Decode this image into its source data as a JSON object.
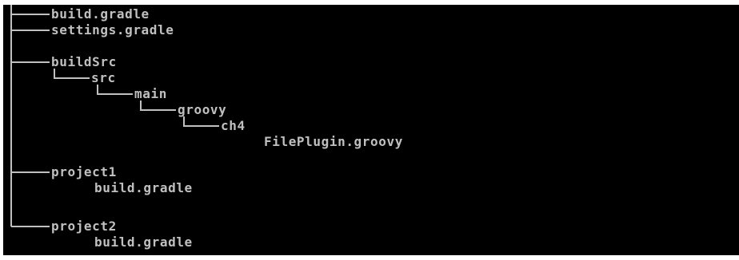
{
  "console": {
    "background": "#000000",
    "foreground": "#c0c0c0",
    "entries": [
      {
        "text": "build.gradle"
      },
      {
        "text": "settings.gradle"
      },
      {
        "text": "buildSrc"
      },
      {
        "text": "src"
      },
      {
        "text": "main"
      },
      {
        "text": "groovy"
      },
      {
        "text": "ch4"
      },
      {
        "text": "FilePlugin.groovy"
      },
      {
        "text": "project1"
      },
      {
        "text": "build.gradle"
      },
      {
        "text": "project2"
      },
      {
        "text": "build.gradle"
      }
    ]
  }
}
